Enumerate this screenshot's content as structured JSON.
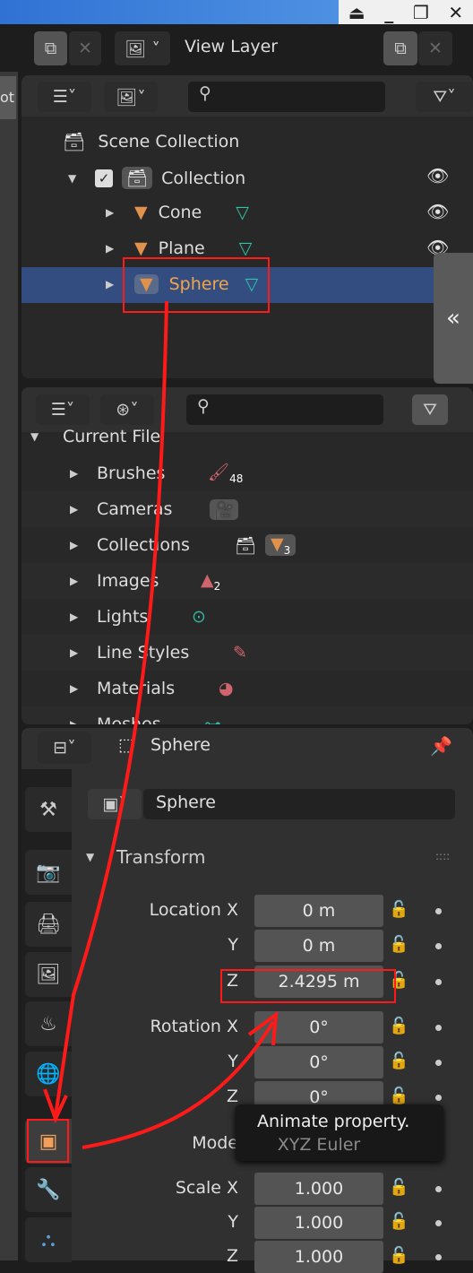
{
  "window": {
    "buttons": [
      "eject-icon",
      "minimize-icon",
      "restore-icon",
      "close-icon"
    ],
    "title_color": "#3b82e0"
  },
  "top_bar": {
    "view_layer": "View Layer"
  },
  "left_strip": {
    "tab_text": "ot"
  },
  "outliner": {
    "rows": [
      {
        "label": "Scene Collection",
        "icon": "collection-icon"
      },
      {
        "label": "Collection",
        "icon": "collection-icon",
        "checked": true,
        "visible": true
      },
      {
        "label": "Cone",
        "icon": "object-cone-icon",
        "visible": true
      },
      {
        "label": "Plane",
        "icon": "object-plane-icon",
        "visible": true
      },
      {
        "label": "Sphere",
        "icon": "object-sphere-icon",
        "selected": true
      }
    ],
    "sidebar_toggle": "«"
  },
  "blend_file": {
    "root": "Current File",
    "items": [
      {
        "label": "Brushes",
        "count": "48",
        "color": "#d0646e"
      },
      {
        "label": "Cameras",
        "color": "#2fb7a0"
      },
      {
        "label": "Collections",
        "count": "3",
        "color": "#e0914c"
      },
      {
        "label": "Images",
        "count": "2",
        "color": "#d0646e"
      },
      {
        "label": "Lights",
        "color": "#2fb7a0"
      },
      {
        "label": "Line Styles",
        "color": "#d0646e"
      },
      {
        "label": "Materials",
        "color": "#d0646e"
      },
      {
        "label": "Meshes",
        "color": "#2fb7a0"
      }
    ]
  },
  "properties": {
    "context": "Sphere",
    "object_name": "Sphere",
    "panel_title": "Transform",
    "location": {
      "label": "Location X",
      "x": "0 m",
      "y": "0 m",
      "z": "2.4295 m"
    },
    "rotation": {
      "label": "Rotation X",
      "x": "0°",
      "y": "0°",
      "z": "0°"
    },
    "mode": {
      "label": "Mode",
      "value": "XYZ Euler"
    },
    "scale": {
      "label": "Scale X",
      "x": "1.000",
      "y": "1.000",
      "z": "1.000"
    },
    "axis": {
      "y": "Y",
      "z": "Z"
    },
    "tooltip": "Animate property.",
    "active_tab": "object"
  },
  "annotation_color": "#ff1a1a"
}
